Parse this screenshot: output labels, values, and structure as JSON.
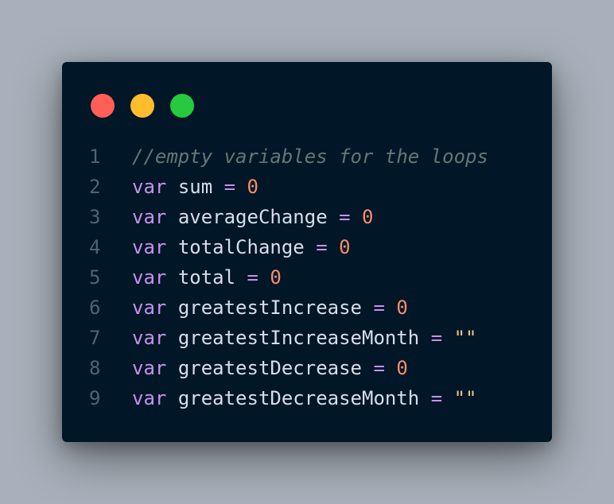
{
  "colors": {
    "background": "#a8b1bb",
    "editor_bg": "#011627",
    "close": "#ff5f56",
    "minimize": "#ffbd2e",
    "maximize": "#27c93f"
  },
  "code": {
    "lines": [
      {
        "number": "1",
        "comment": "//empty variables for the loops"
      },
      {
        "number": "2",
        "keyword": "var",
        "name": "sum",
        "operator": "=",
        "value": "0",
        "value_type": "num"
      },
      {
        "number": "3",
        "keyword": "var",
        "name": "averageChange",
        "operator": "=",
        "value": "0",
        "value_type": "num"
      },
      {
        "number": "4",
        "keyword": "var",
        "name": "totalChange",
        "operator": "=",
        "value": "0",
        "value_type": "num"
      },
      {
        "number": "5",
        "keyword": "var",
        "name": "total",
        "operator": "=",
        "value": "0",
        "value_type": "num"
      },
      {
        "number": "6",
        "keyword": "var",
        "name": "greatestIncrease",
        "operator": "=",
        "value": "0",
        "value_type": "num"
      },
      {
        "number": "7",
        "keyword": "var",
        "name": "greatestIncreaseMonth",
        "operator": "=",
        "value": "\"\"",
        "value_type": "str"
      },
      {
        "number": "8",
        "keyword": "var",
        "name": "greatestDecrease",
        "operator": "=",
        "value": "0",
        "value_type": "num"
      },
      {
        "number": "9",
        "keyword": "var",
        "name": "greatestDecreaseMonth",
        "operator": "=",
        "value": "\"\"",
        "value_type": "str"
      }
    ]
  }
}
